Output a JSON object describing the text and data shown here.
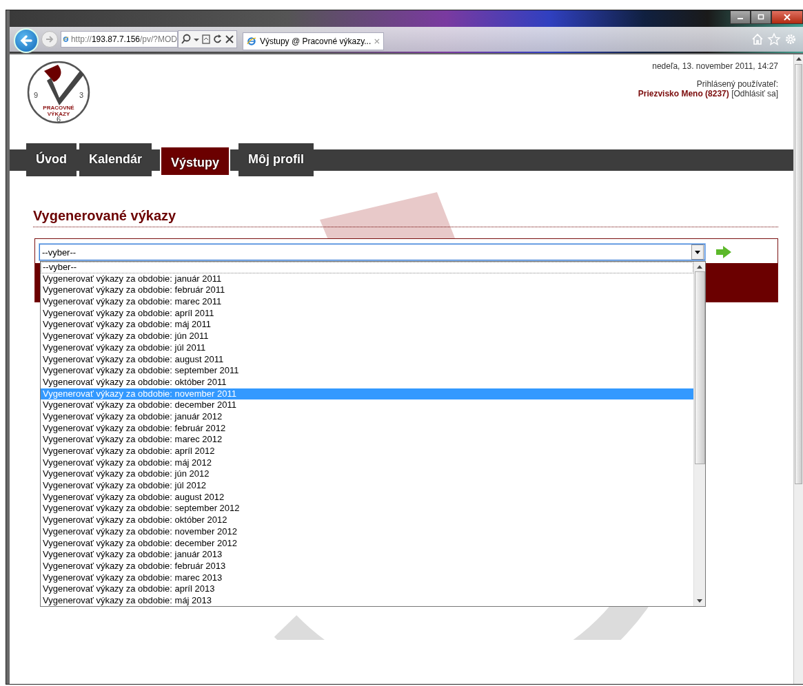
{
  "browser": {
    "address": {
      "scheme": "http://",
      "host": "193.87.7.156",
      "path": "/pv/?MOD"
    },
    "tab_title": "Výstupy @ Pracovné výkazy..."
  },
  "header": {
    "logo": {
      "numerals": [
        "9",
        "3",
        "6"
      ],
      "lines": [
        "PRACOVNÉ",
        "VÝKAZY"
      ]
    },
    "datetime": "nedeľa, 13. november 2011, 14:27",
    "user_label": "Prihlásený používateľ:",
    "user_name": "Priezvisko Meno (8237)",
    "logout": "[Odhlásiť sa]"
  },
  "nav": [
    {
      "label": "Úvod",
      "selected": false
    },
    {
      "label": "Kalendár",
      "selected": false
    },
    {
      "label": "Výstupy",
      "selected": true
    },
    {
      "label": "Môj profil",
      "selected": false
    }
  ],
  "section": {
    "title": "Vygenerované výkazy",
    "select": {
      "value": "--vyber--",
      "expanded": true,
      "options": [
        {
          "label": "--vyber--",
          "selected": true,
          "highlighted": false
        },
        {
          "label": "Vygenerovať výkazy za obdobie: január 2011",
          "selected": false,
          "highlighted": false
        },
        {
          "label": "Vygenerovať výkazy za obdobie: február 2011",
          "selected": false,
          "highlighted": false
        },
        {
          "label": "Vygenerovať výkazy za obdobie: marec 2011",
          "selected": false,
          "highlighted": false
        },
        {
          "label": "Vygenerovať výkazy za obdobie: apríl 2011",
          "selected": false,
          "highlighted": false
        },
        {
          "label": "Vygenerovať výkazy za obdobie: máj 2011",
          "selected": false,
          "highlighted": false
        },
        {
          "label": "Vygenerovať výkazy za obdobie: jún 2011",
          "selected": false,
          "highlighted": false
        },
        {
          "label": "Vygenerovať výkazy za obdobie: júl 2011",
          "selected": false,
          "highlighted": false
        },
        {
          "label": "Vygenerovať výkazy za obdobie: august 2011",
          "selected": false,
          "highlighted": false
        },
        {
          "label": "Vygenerovať výkazy za obdobie: september 2011",
          "selected": false,
          "highlighted": false
        },
        {
          "label": "Vygenerovať výkazy za obdobie: október 2011",
          "selected": false,
          "highlighted": false
        },
        {
          "label": "Vygenerovať výkazy za obdobie: november 2011",
          "selected": false,
          "highlighted": true
        },
        {
          "label": "Vygenerovať výkazy za obdobie: december 2011",
          "selected": false,
          "highlighted": false
        },
        {
          "label": "Vygenerovať výkazy za obdobie: január 2012",
          "selected": false,
          "highlighted": false
        },
        {
          "label": "Vygenerovať výkazy za obdobie: február 2012",
          "selected": false,
          "highlighted": false
        },
        {
          "label": "Vygenerovať výkazy za obdobie: marec 2012",
          "selected": false,
          "highlighted": false
        },
        {
          "label": "Vygenerovať výkazy za obdobie: apríl 2012",
          "selected": false,
          "highlighted": false
        },
        {
          "label": "Vygenerovať výkazy za obdobie: máj 2012",
          "selected": false,
          "highlighted": false
        },
        {
          "label": "Vygenerovať výkazy za obdobie: jún 2012",
          "selected": false,
          "highlighted": false
        },
        {
          "label": "Vygenerovať výkazy za obdobie: júl 2012",
          "selected": false,
          "highlighted": false
        },
        {
          "label": "Vygenerovať výkazy za obdobie: august 2012",
          "selected": false,
          "highlighted": false
        },
        {
          "label": "Vygenerovať výkazy za obdobie: september 2012",
          "selected": false,
          "highlighted": false
        },
        {
          "label": "Vygenerovať výkazy za obdobie: október 2012",
          "selected": false,
          "highlighted": false
        },
        {
          "label": "Vygenerovať výkazy za obdobie: november 2012",
          "selected": false,
          "highlighted": false
        },
        {
          "label": "Vygenerovať výkazy za obdobie: december 2012",
          "selected": false,
          "highlighted": false
        },
        {
          "label": "Vygenerovať výkazy za obdobie: január 2013",
          "selected": false,
          "highlighted": false
        },
        {
          "label": "Vygenerovať výkazy za obdobie: február 2013",
          "selected": false,
          "highlighted": false
        },
        {
          "label": "Vygenerovať výkazy za obdobie: marec 2013",
          "selected": false,
          "highlighted": false
        },
        {
          "label": "Vygenerovať výkazy za obdobie: apríl 2013",
          "selected": false,
          "highlighted": false
        },
        {
          "label": "Vygenerovať výkazy za obdobie: máj 2013",
          "selected": false,
          "highlighted": false
        }
      ]
    }
  }
}
